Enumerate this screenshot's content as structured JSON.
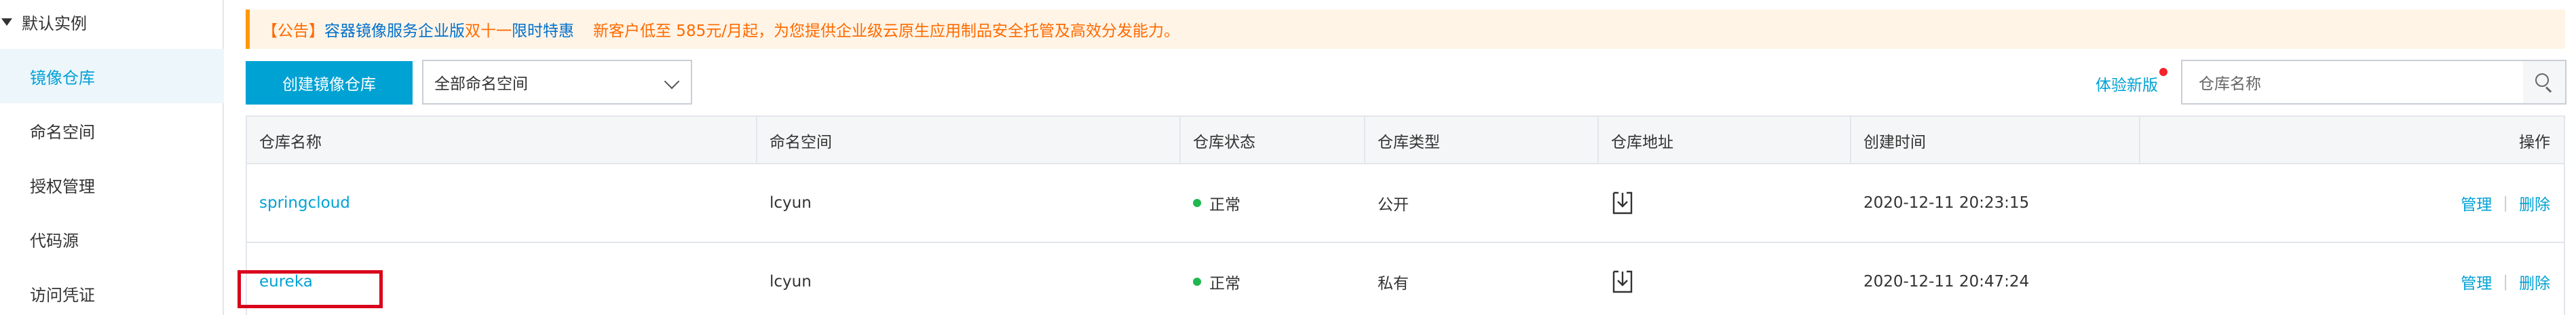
{
  "sidebar": {
    "group_label": "默认实例",
    "items": [
      {
        "label": "镜像仓库",
        "active": true
      },
      {
        "label": "命名空间",
        "active": false
      },
      {
        "label": "授权管理",
        "active": false
      },
      {
        "label": "代码源",
        "active": false
      },
      {
        "label": "访问凭证",
        "active": false
      }
    ]
  },
  "notice": {
    "tag": "【公告】",
    "product": "容器镜像服务企业版",
    "promo": "双十一",
    "highlight": "限时特惠",
    "body": "新客户低至 585元/月起，为您提供企业级云原生应用制品安全托管及高效分发能力。"
  },
  "toolbar": {
    "create_label": "创建镜像仓库",
    "namespace_selected": "全部命名空间",
    "try_new_label": "体验新版",
    "search_placeholder": "仓库名称"
  },
  "table": {
    "columns": [
      "仓库名称",
      "命名空间",
      "仓库状态",
      "仓库类型",
      "仓库地址",
      "创建时间",
      "操作"
    ],
    "rows": [
      {
        "name": "springcloud",
        "namespace": "lcyun",
        "status": "正常",
        "type": "公开",
        "created": "2020-12-11 20:23:15",
        "op_manage": "管理",
        "op_sep": "|",
        "op_delete": "删除"
      },
      {
        "name": "eureka",
        "namespace": "lcyun",
        "status": "正常",
        "type": "私有",
        "created": "2020-12-11 20:47:24",
        "op_manage": "管理",
        "op_sep": "|",
        "op_delete": "删除"
      }
    ]
  },
  "colors": {
    "accent": "#00a2d4",
    "status_ok": "#1fb84e",
    "notice_text": "#ff6a00",
    "highlight_box": "#d9001b"
  },
  "icons": [
    "caret-down-icon",
    "chevron-down-icon",
    "search-icon",
    "download-address-icon"
  ]
}
